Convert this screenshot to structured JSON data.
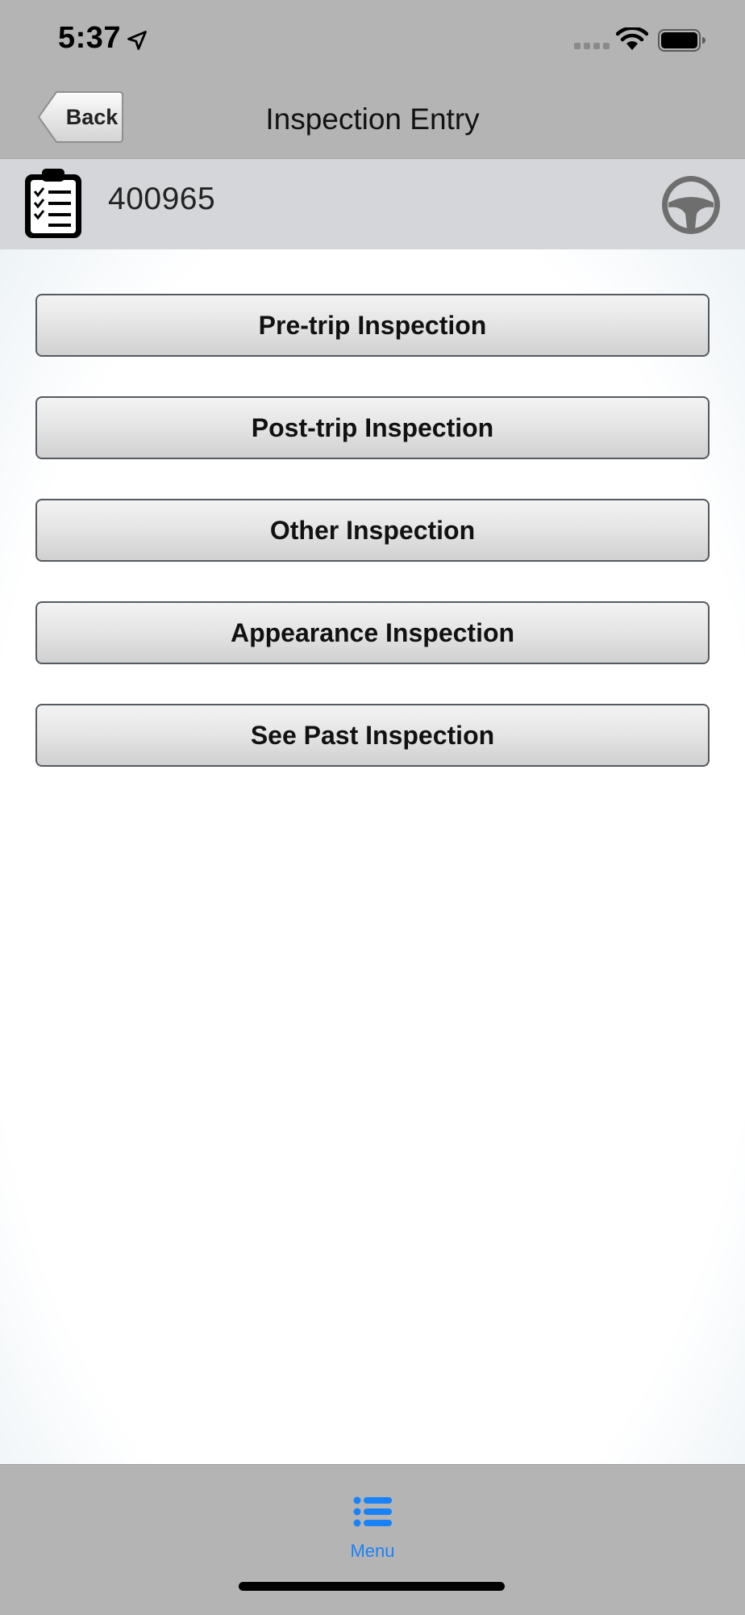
{
  "status_bar": {
    "time": "5:37",
    "location_icon": "location-arrow-icon",
    "signal_icon": "cellular-signal-icon",
    "wifi_icon": "wifi-icon",
    "battery_icon": "battery-icon"
  },
  "nav": {
    "back_label": "Back",
    "title": "Inspection Entry"
  },
  "vehicle": {
    "icon": "clipboard-checklist-icon",
    "number": "400965",
    "status_icon": "steering-wheel-icon"
  },
  "menu": {
    "items": [
      {
        "label": "Pre-trip Inspection"
      },
      {
        "label": "Post-trip Inspection"
      },
      {
        "label": "Other Inspection"
      },
      {
        "label": "Appearance Inspection"
      },
      {
        "label": "See Past Inspection"
      }
    ]
  },
  "tab_bar": {
    "menu_label": "Menu",
    "menu_icon": "list-icon"
  },
  "colors": {
    "bar_gray": "#b4b4b4",
    "header_gray": "#d4d6d9",
    "tab_active": "#1a82f7"
  }
}
